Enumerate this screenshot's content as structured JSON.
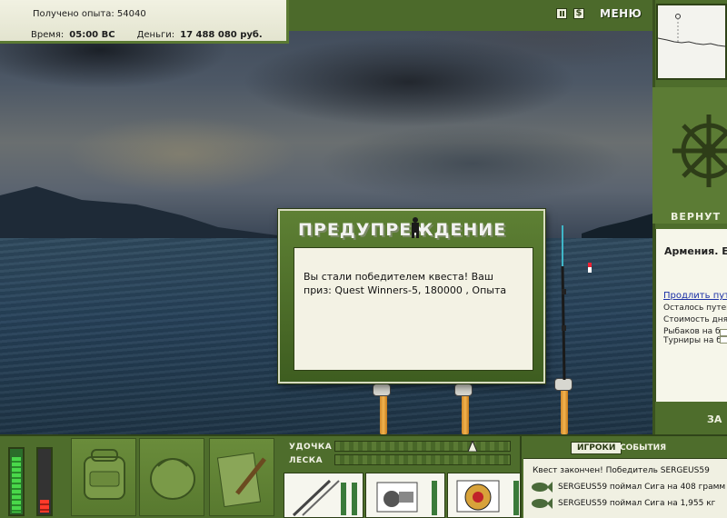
{
  "info": {
    "experience_label": "Получено опыта:",
    "experience_value": "54040",
    "time_label": "Время:",
    "time_value": "05:00 ВС",
    "money_label": "Деньги:",
    "money_value": "17 488 080 руб."
  },
  "top_bar": {
    "menu_label": "МЕНЮ"
  },
  "right_panel": {
    "return_label": "ВЕРНУТ",
    "location_title": "Армения. Е",
    "extend_link": "Продлить путе",
    "lines": [
      "Осталось путев",
      "Стоимость дня:",
      "Рыбаков на баз",
      "Турниры на баз"
    ],
    "bottom_label": "ЗА"
  },
  "dialog": {
    "title": "ПРЕДУПРЕЖДЕНИЕ",
    "message": "Вы стали победителем квеста! Ваш приз: Quest Winners-5, 180000 , Опыта"
  },
  "gauges": {
    "fish_level": 0.9,
    "tension_level": 0.2
  },
  "bottom_bar": {
    "rod_label": "УДОЧКА",
    "line_label": "ЛЕСКА",
    "tabs": [
      "ИГРОКИ",
      "СОБЫТИЯ"
    ],
    "events": [
      "Квест закончен! Победитель SERGEUS59",
      "SERGEUS59 поймал Сига на 408 грамм",
      "SERGEUS59 поймал Сига на 1,955 кг"
    ]
  },
  "colors": {
    "panel_green": "#4e6d2c",
    "dialog_green": "#5e8034",
    "link_blue": "#1a2fa6"
  }
}
